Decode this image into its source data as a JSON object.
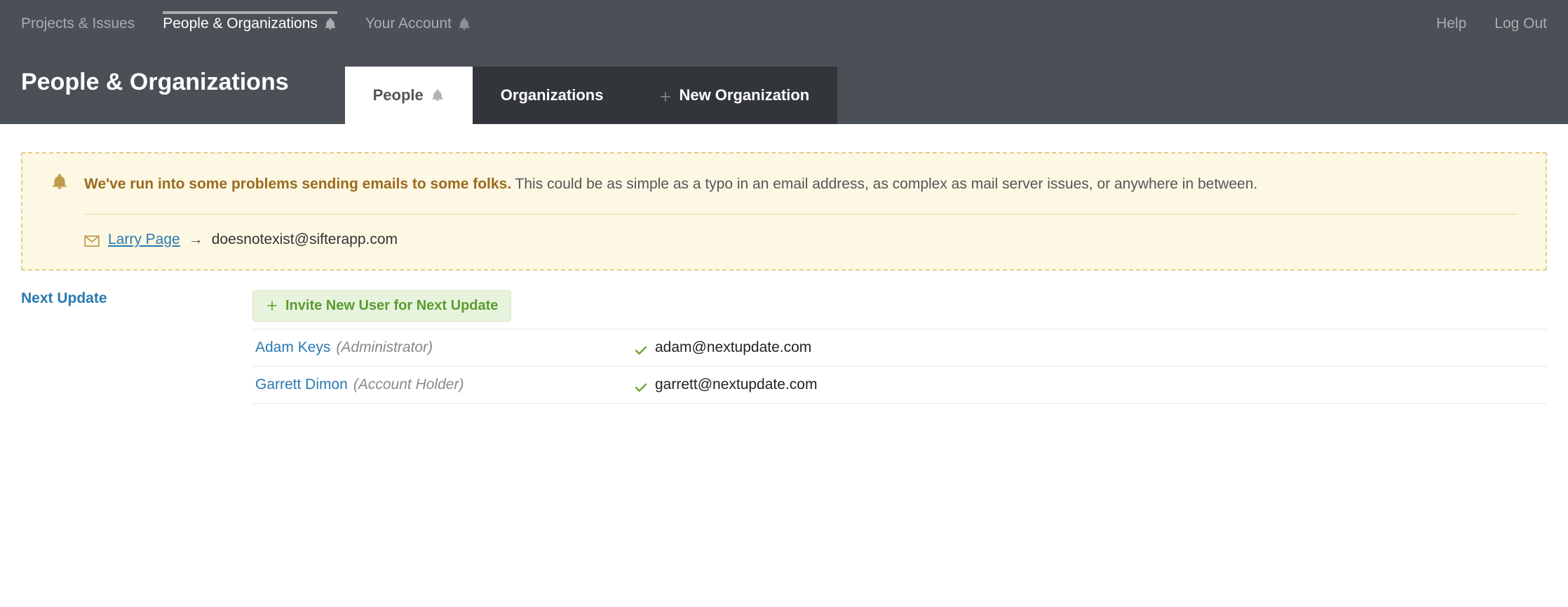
{
  "nav": {
    "projects": "Projects & Issues",
    "people": "People & Organizations",
    "account": "Your Account",
    "help": "Help",
    "logout": "Log Out"
  },
  "page": {
    "title": "People & Organizations"
  },
  "tabs": {
    "people": "People",
    "organizations": "Organizations",
    "new_org": "New Organization"
  },
  "alert": {
    "strong": "We've run into some problems sending emails to some folks.",
    "rest": " This could be as simple as a typo in an email address, as complex as mail server issues, or anywhere in between.",
    "person": "Larry Page",
    "arrow": "→",
    "email": "doesnotexist@sifterapp.com"
  },
  "side": {
    "org": "Next Update"
  },
  "invite": {
    "label": "Invite New User for Next Update"
  },
  "users": [
    {
      "name": "Adam Keys",
      "role": "(Administrator)",
      "email": "adam@nextupdate.com"
    },
    {
      "name": "Garrett Dimon",
      "role": "(Account Holder)",
      "email": "garrett@nextupdate.com"
    }
  ]
}
